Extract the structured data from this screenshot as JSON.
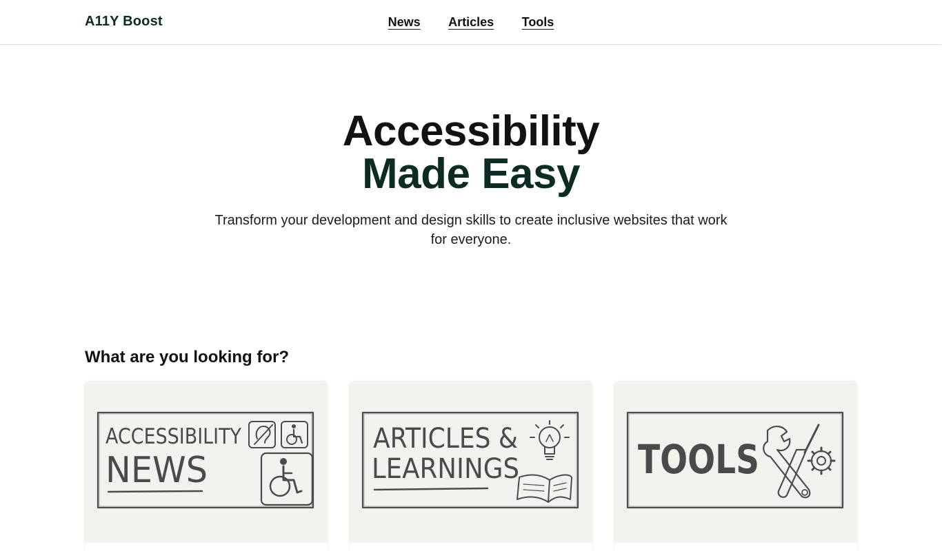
{
  "header": {
    "brand": "A11Y Boost",
    "nav": [
      {
        "label": "News"
      },
      {
        "label": "Articles"
      },
      {
        "label": "Tools"
      }
    ]
  },
  "hero": {
    "title_line1": "Accessibility",
    "title_line2": "Made Easy",
    "subtitle": "Transform your development and design skills to create inclusive websites that work for everyone."
  },
  "section": {
    "title": "What are you looking for?"
  },
  "cards": [
    {
      "line1": "ACCESSIBILITY",
      "line2": "NEWS",
      "icons": [
        "hearing-icon",
        "wheelchair-icon"
      ]
    },
    {
      "line1": "ARTICLES &",
      "line2": "LEARNINGS",
      "icons": [
        "lightbulb-icon",
        "book-icon"
      ]
    },
    {
      "line1": "TOOLS",
      "icons": [
        "wrench-icon",
        "screwdriver-icon",
        "gear-icon"
      ]
    }
  ],
  "colors": {
    "brand": "#0c2b24",
    "text": "#111111",
    "card_bg": "#f3f2ef"
  }
}
